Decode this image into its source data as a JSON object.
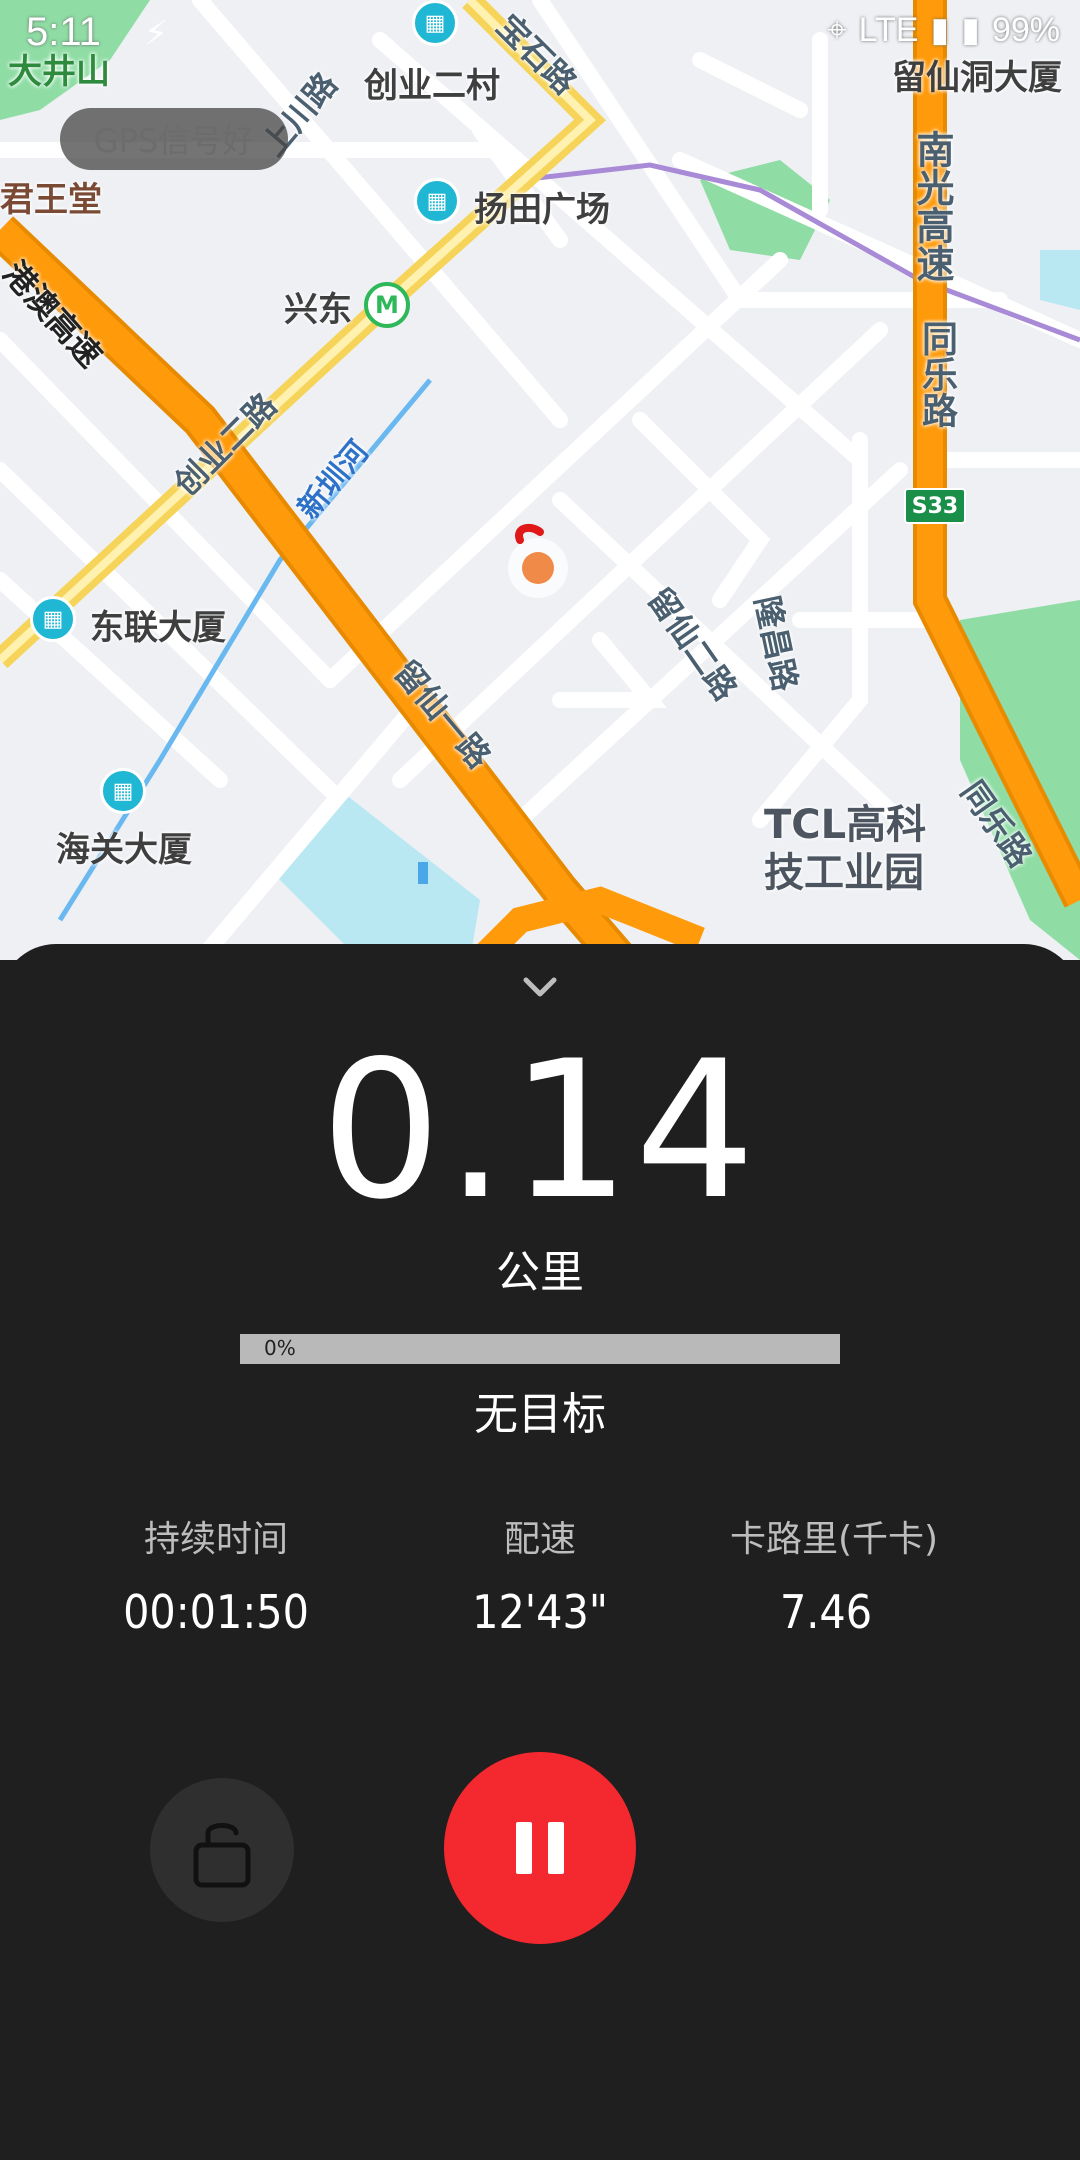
{
  "status_bar": {
    "time": "5:11",
    "network": "LTE",
    "battery": "99%"
  },
  "map": {
    "gps_status": "GPS信号好",
    "places": [
      "大井山",
      "创业二村",
      "扬田广场",
      "兴东",
      "东联大厦",
      "海关大厦",
      "留仙洞大厦",
      "TCL高科",
      "技工业园"
    ],
    "roads": [
      "宝石路",
      "上川路",
      "南光高速",
      "同乐路",
      "港澳高速",
      "创业二路",
      "新圳河",
      "留仙一路",
      "留仙二路",
      "隆昌路",
      "同乐路"
    ],
    "partial": [
      "君王堂"
    ],
    "highway_badge": "S33"
  },
  "panel": {
    "distance": "0.14",
    "unit": "公里",
    "progress_percent": 0,
    "progress_label": "0%",
    "goal": "无目标",
    "stats": [
      {
        "label": "持续时间",
        "value": "00:01:50"
      },
      {
        "label": "配速",
        "value": "12'43\""
      },
      {
        "label": "卡路里(千卡)",
        "value": "7.46"
      }
    ]
  },
  "colors": {
    "pause": "#f4282f",
    "panel": "#1f1f1f",
    "highway": "#ff9a0a",
    "park": "#8fdda5",
    "water": "#b9e8f3"
  },
  "icons": [
    "chevron-down-icon",
    "lock-icon",
    "pause-icon",
    "location-icon",
    "running-icon",
    "signal-icon",
    "battery-icon"
  ]
}
